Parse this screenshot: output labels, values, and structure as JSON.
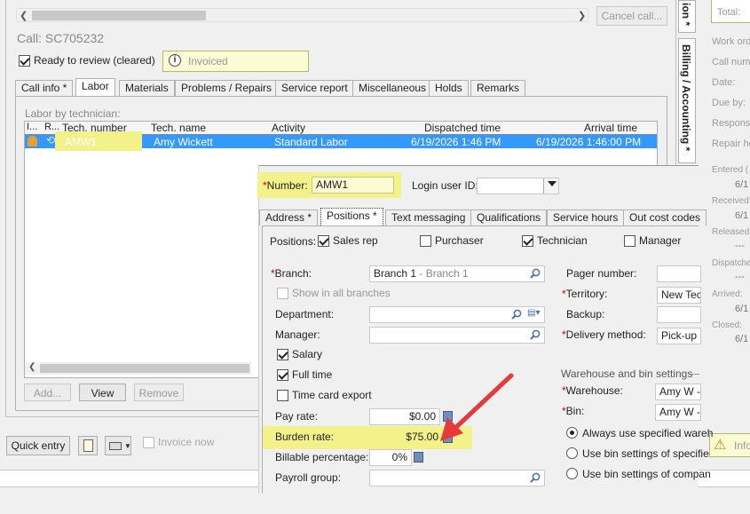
{
  "toolbar": {
    "cancel_call": "Cancel call..."
  },
  "call": {
    "title": "Call: SC705232",
    "ready_label": "Ready to review (cleared)",
    "status": "Invoiced"
  },
  "tabs": [
    "Call info *",
    "Labor",
    "Materials",
    "Problems / Repairs",
    "Service report",
    "Miscellaneous",
    "Holds",
    "Remarks"
  ],
  "labor": {
    "section_label": "Labor by technician:",
    "columns": [
      "I...",
      "R...",
      "Tech. number",
      "Tech. name",
      "Activity",
      "Dispatched time",
      "Arrival time"
    ],
    "row": {
      "tech_number": "AMW1",
      "tech_name": "Amy Wickett",
      "activity": "Standard Labor",
      "dispatched": "6/19/2026 1:46 PM",
      "arrival": "6/19/2026 1:46:00 PM"
    },
    "buttons": {
      "add": "Add...",
      "view": "View",
      "remove": "Remove"
    }
  },
  "bottom": {
    "quick_entry": "Quick entry",
    "invoice_now": "Invoice now"
  },
  "vertical_tabs": {
    "top": "ion *",
    "billing": "Billing / Accounting *"
  },
  "right_panel": {
    "total": "Total:",
    "fields": [
      "Work ord",
      "Call num",
      "Date:",
      "Due by:",
      "Respons",
      "Repair ho"
    ],
    "dates": [
      {
        "label": "Entered (",
        "value": "6/1"
      },
      {
        "label": "Received:",
        "value": "6/1"
      },
      {
        "label": "Released:",
        "value": "---"
      },
      {
        "label": "Dispatched",
        "value": "---"
      },
      {
        "label": "Arrived:",
        "value": "6/1"
      },
      {
        "label": "Closed:",
        "value": "6/1"
      }
    ],
    "info": "Info"
  },
  "tech": {
    "number_label": "Number:",
    "number_value": "AMW1",
    "login_label": "Login user ID:",
    "login_value": "",
    "subtabs": [
      "Address *",
      "Positions *",
      "Text messaging",
      "Qualifications",
      "Service hours",
      "Out cost codes"
    ],
    "positions_label": "Positions:",
    "positions": [
      {
        "label": "Sales rep",
        "checked": true
      },
      {
        "label": "Purchaser",
        "checked": false
      },
      {
        "label": "Technician",
        "checked": true
      },
      {
        "label": "Manager",
        "checked": false
      }
    ],
    "branch_label": "Branch:",
    "branch_value": "Branch 1",
    "branch_desc": "- Branch 1",
    "show_all_branches": "Show in all branches",
    "department_label": "Department:",
    "manager_label": "Manager:",
    "salary": "Salary",
    "full_time": "Full time",
    "time_card": "Time card export",
    "pay_rate_label": "Pay rate:",
    "pay_rate": "$0.00",
    "burden_rate_label": "Burden rate:",
    "burden_rate": "$75.00",
    "billable_label": "Billable percentage:",
    "billable": "0%",
    "payroll_label": "Payroll group:",
    "pager_label": "Pager number:",
    "territory_label": "Territory:",
    "territory_value": "New Tech",
    "backup_label": "Backup:",
    "delivery_label": "Delivery method:",
    "delivery_value": "Pick-up",
    "warehouse_section": "Warehouse and bin settings",
    "warehouse_label": "Warehouse:",
    "warehouse_value": "Amy W - A",
    "bin_label": "Bin:",
    "bin_value": "Amy W - A",
    "radio_options": [
      "Always use specified wareh",
      "Use bin settings of specifie",
      "Use bin settings of compan"
    ]
  }
}
